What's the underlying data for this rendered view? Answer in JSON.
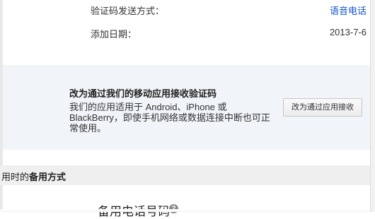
{
  "settings": {
    "method_label": "验证码发送方式：",
    "method_value": "语音电话",
    "date_label": "添加日期：",
    "date_value": "2013-7-6"
  },
  "app_promo": {
    "title": "改为通过我们的移动应用接收验证码",
    "description": "我们的应用适用于 Android、iPhone 或 BlackBerry，即使手机网络或数据连接中断也可正常使用。",
    "button_label": "改为通过应用接收"
  },
  "backup": {
    "header_prefix": "用时的",
    "header_bold": "备用方式",
    "phone_title": "备用电话号码",
    "help_icon": "?"
  },
  "colors": {
    "link": "#1155cc",
    "promo_bg": "#f1f4f8",
    "header_bg": "#efefef"
  }
}
